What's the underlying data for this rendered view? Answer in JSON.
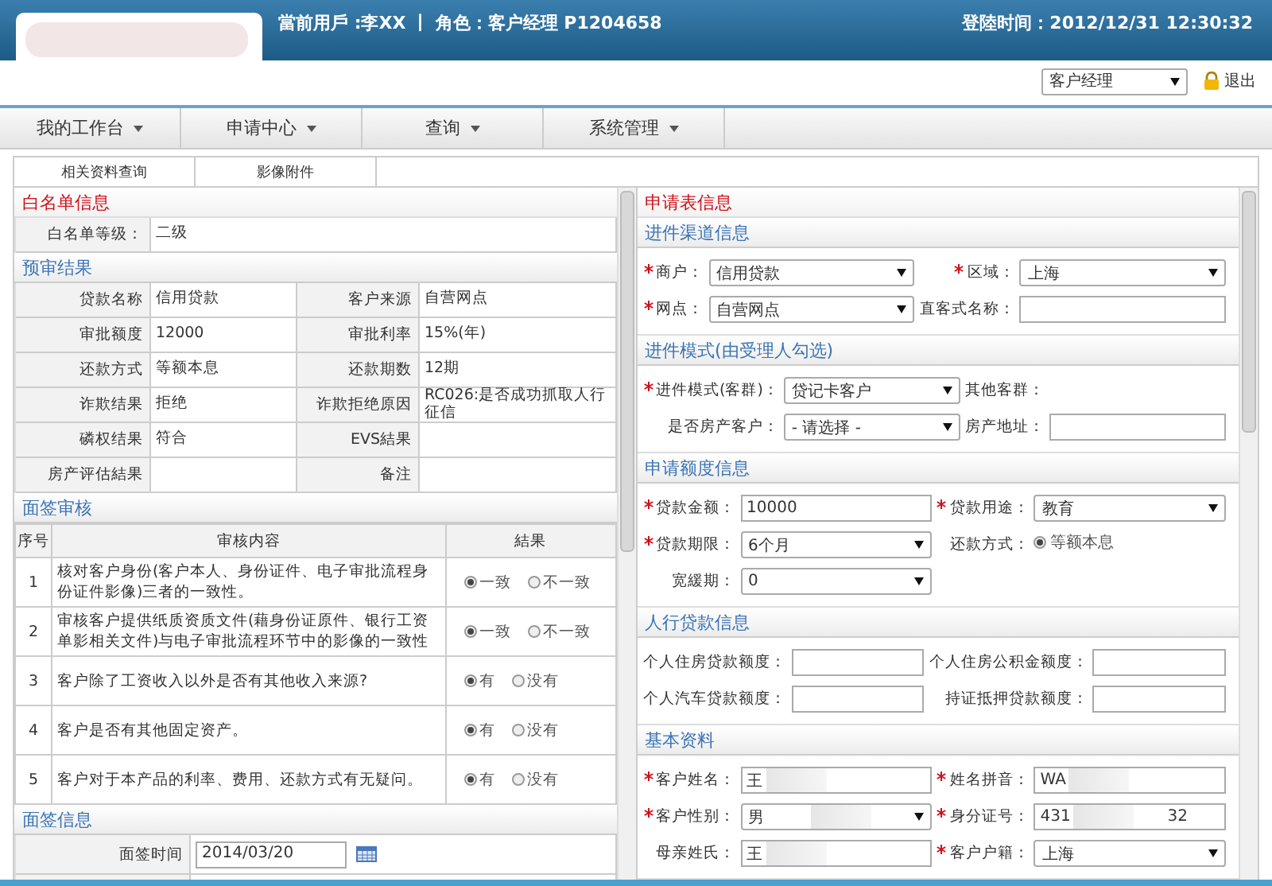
{
  "header": {
    "user_info": "當前用戶 :李XX  丨 角色：客户经理 P1204658",
    "login_time": "登陸时间：2012/12/31  12:30:32",
    "role_select": "客户经理",
    "logout": "退出"
  },
  "menu": [
    {
      "label": "我的工作台"
    },
    {
      "label": "申请中心"
    },
    {
      "label": "查询"
    },
    {
      "label": "系统管理"
    }
  ],
  "subtabs": [
    {
      "label": "相关资料查询"
    },
    {
      "label": "影像附件"
    }
  ],
  "left": {
    "whitelist": {
      "title": "白名单信息",
      "rows": [
        {
          "label": "白名单等级：",
          "value": "二级"
        }
      ]
    },
    "pre_review": {
      "title": "预审结果",
      "rows": [
        [
          {
            "label": "贷款名称",
            "value": "信用贷款"
          },
          {
            "label": "客户来源",
            "value": "自营网点"
          }
        ],
        [
          {
            "label": "审批额度",
            "value": "12000"
          },
          {
            "label": "审批利率",
            "value": "15%(年)"
          }
        ],
        [
          {
            "label": "还款方式",
            "value": "等额本息"
          },
          {
            "label": "还款期数",
            "value": "12期"
          }
        ],
        [
          {
            "label": "诈欺结果",
            "value": "拒绝"
          },
          {
            "label": "诈欺拒绝原因",
            "value": "RC026:是否成功抓取人行征信"
          }
        ],
        [
          {
            "label": "磷权结果",
            "value": "符合"
          },
          {
            "label": "EVS結果"
          }
        ],
        [
          {
            "label": "房产评估結果"
          },
          {
            "label": "备注"
          }
        ]
      ]
    },
    "interview_review": {
      "title": "面签审核",
      "columns": [
        "序号",
        "审核内容",
        "結果"
      ],
      "rows": [
        {
          "no": "1",
          "content": "核对客户身份(客户本人、身份证件、电子审批流程身份证件影像)三者的一致性。",
          "options": [
            {
              "label": "一致",
              "selected": true
            },
            {
              "label": "不一致",
              "selected": false
            }
          ]
        },
        {
          "no": "2",
          "content": "审核客户提供纸质资质文件(藉身份证原件、银行工资单影相关文件)与电子审批流程环节中的影像的一致性",
          "options": [
            {
              "label": "一致",
              "selected": true
            },
            {
              "label": "不一致",
              "selected": false
            }
          ]
        },
        {
          "no": "3",
          "content": "客户除了工资收入以外是否有其他收入来源?",
          "options": [
            {
              "label": "有",
              "selected": true
            },
            {
              "label": "没有",
              "selected": false
            }
          ]
        },
        {
          "no": "4",
          "content": "客户是否有其他固定资产。",
          "options": [
            {
              "label": "有",
              "selected": true
            },
            {
              "label": "没有",
              "selected": false
            }
          ]
        },
        {
          "no": "5",
          "content": "客户对于本产品的利率、费用、还款方式有无疑问。",
          "options": [
            {
              "label": "有",
              "selected": true
            },
            {
              "label": "没有",
              "selected": false
            }
          ]
        }
      ]
    },
    "interview_info": {
      "title": "面签信息",
      "rows": [
        {
          "label": "面签时间",
          "value": "2014/03/20"
        }
      ]
    }
  },
  "right": {
    "title": "申请表信息",
    "sections": [
      {
        "title": "进件渠道信息",
        "fields": [
          {
            "kind": "select",
            "label": "商户：",
            "required": true,
            "value": "信用贷款"
          },
          {
            "kind": "select",
            "label": "区域：",
            "required": true,
            "value": "上海"
          },
          {
            "kind": "select",
            "label": "网点：",
            "required": true,
            "value": "自营网点"
          },
          {
            "kind": "input",
            "label": "直客式名称：",
            "required": false
          }
        ]
      },
      {
        "title": "进件模式(由受理人勾选)",
        "fields": [
          {
            "kind": "select",
            "label": "进件模式(客群)：",
            "required": true,
            "value": "贷记卡客户"
          },
          {
            "kind": "none",
            "label": "其他客群：",
            "required": false
          },
          {
            "kind": "select",
            "label": "是否房产客户：",
            "required": false,
            "value": "- 请选择 -"
          },
          {
            "kind": "input",
            "label": "房产地址：",
            "required": false
          }
        ]
      },
      {
        "title": "申请额度信息",
        "fields": [
          {
            "kind": "input",
            "label": "贷款金额：",
            "required": true,
            "value": "10000"
          },
          {
            "kind": "select",
            "label": "贷款用途：",
            "required": true,
            "value": "教育"
          },
          {
            "kind": "select",
            "label": "贷款期限：",
            "required": true,
            "value": "6个月"
          },
          {
            "kind": "radio",
            "label": "还款方式：",
            "required": false,
            "value": "等额本息",
            "selected": true
          },
          {
            "kind": "select",
            "label": "宽緩期：",
            "required": false,
            "value": "0"
          }
        ]
      },
      {
        "title": "人行贷款信息",
        "fields": [
          {
            "kind": "input",
            "label": "个人住房贷款额度：",
            "required": false
          },
          {
            "kind": "input",
            "label": "个人住房公积金额度：",
            "required": false
          },
          {
            "kind": "input",
            "label": "个人汽车贷款额度：",
            "required": false
          },
          {
            "kind": "input",
            "label": "持证抵押贷款额度：",
            "required": false
          }
        ]
      },
      {
        "title": "基本资料",
        "fields": [
          {
            "kind": "input",
            "label": "客户姓名：",
            "required": true,
            "value": "王",
            "redacted": true
          },
          {
            "kind": "input",
            "label": "姓名拼音：",
            "required": true,
            "value": "WA",
            "redacted": true
          },
          {
            "kind": "select",
            "label": "客户性别：",
            "required": true,
            "value": "男",
            "redacted": true
          },
          {
            "kind": "input",
            "label": "身分证号：",
            "required": true,
            "value": "431",
            "tail": "32",
            "redacted": true
          },
          {
            "kind": "input",
            "label": "母亲姓氏：",
            "required": false,
            "value": "王",
            "redacted": true
          },
          {
            "kind": "select",
            "label": "客户户籍：",
            "required": true,
            "value": "上海"
          }
        ]
      }
    ]
  }
}
